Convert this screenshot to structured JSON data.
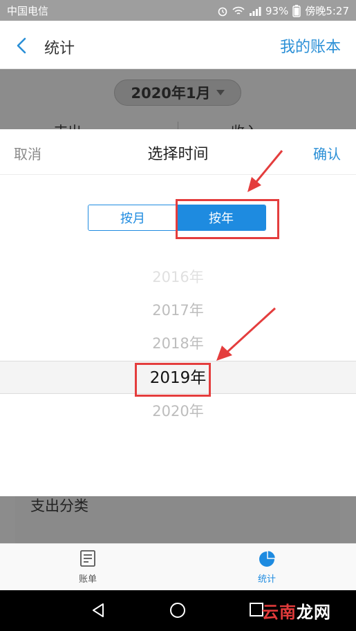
{
  "status_bar": {
    "carrier": "中国电信",
    "battery": "93%",
    "time": "傍晚5:27"
  },
  "nav": {
    "back_icon": "chevron-left-icon",
    "title": "统计",
    "right_link": "我的账本"
  },
  "background": {
    "period_selector": "2020年1月",
    "peek_left": "支出",
    "peek_right": "收入",
    "category_title": "支出分类"
  },
  "picker": {
    "cancel": "取消",
    "title": "选择时间",
    "confirm": "确认",
    "segments": {
      "month": "按月",
      "year": "按年",
      "selected": "year"
    },
    "years": [
      "2016年",
      "2017年",
      "2018年",
      "2019年",
      "2020年"
    ],
    "selected_year": "2019年"
  },
  "tabs": [
    {
      "label": "账单",
      "icon": "bill-list-icon",
      "active": false
    },
    {
      "label": "统计",
      "icon": "pie-chart-icon",
      "active": true
    }
  ],
  "watermark": {
    "red": "云南",
    "white": "龙网"
  },
  "colors": {
    "accent": "#1e8be0",
    "annotation": "#e43d3d"
  }
}
